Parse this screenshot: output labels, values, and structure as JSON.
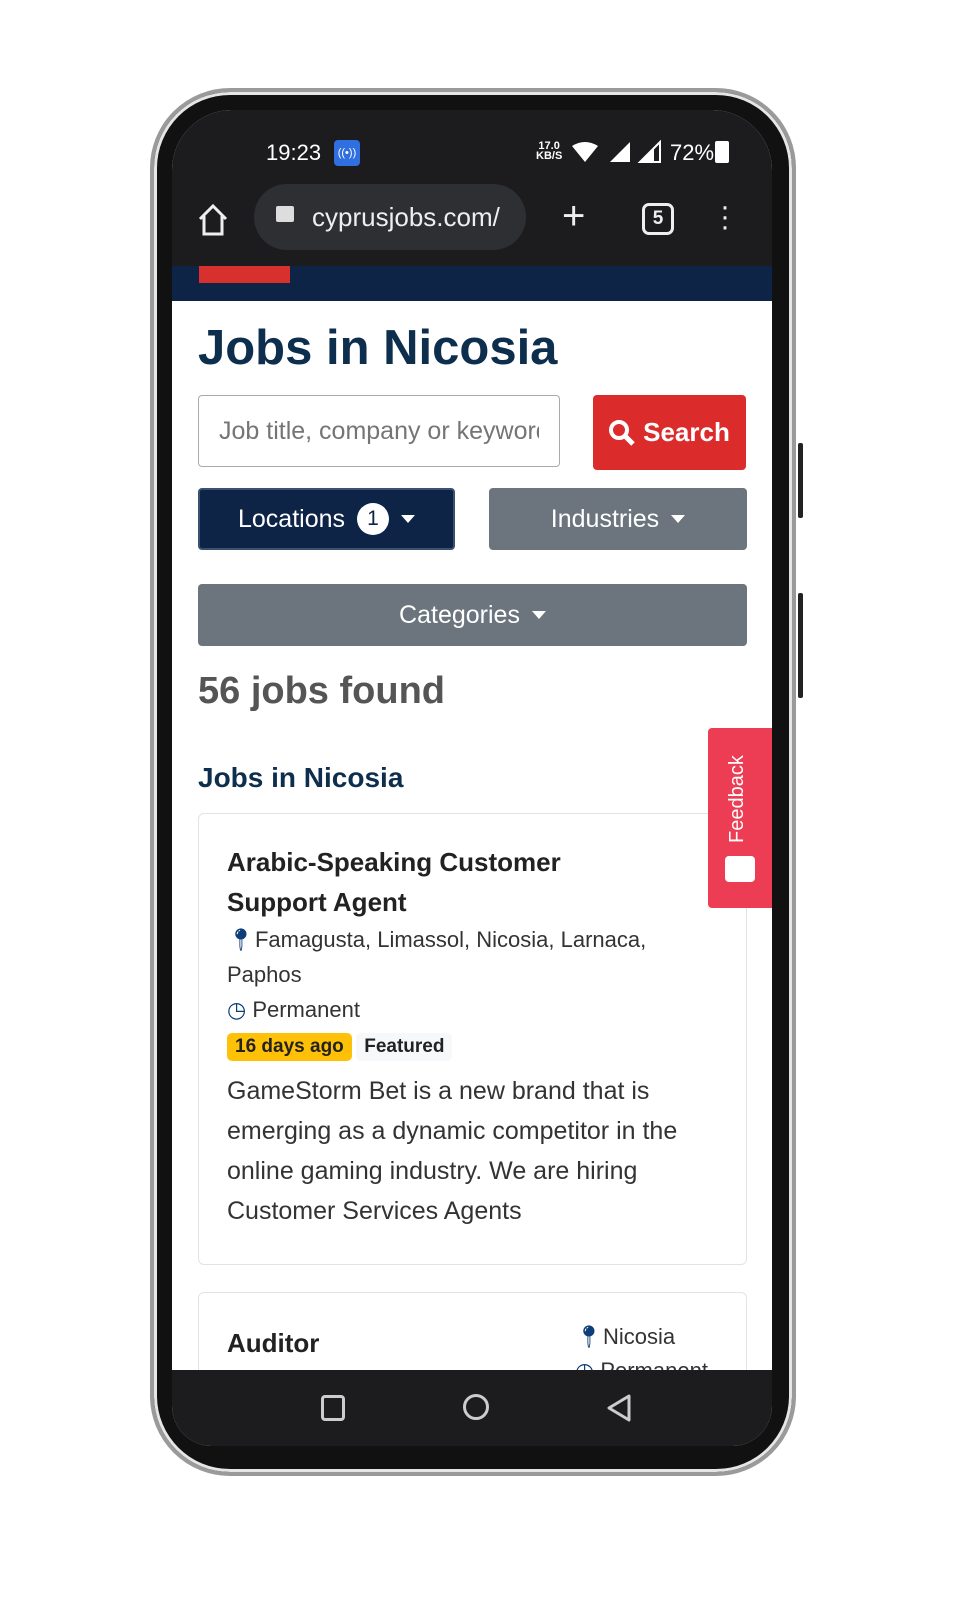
{
  "status_bar": {
    "time": "19:23",
    "net_speed_value": "17.0",
    "net_speed_unit": "KB/S",
    "battery": "72%"
  },
  "browser": {
    "url": "cyprusjobs.com/",
    "tab_count": "5"
  },
  "page": {
    "title": "Jobs in Nicosia",
    "search_placeholder": "Job title, company or keywords",
    "search_button": "Search",
    "filters": {
      "locations": "Locations",
      "locations_count": "1",
      "industries": "Industries",
      "categories": "Categories"
    },
    "results_count": "56 jobs found",
    "section_title": "Jobs in Nicosia"
  },
  "jobs": [
    {
      "title": "Arabic-Speaking Customer Support Agent",
      "locations": "Famagusta, Limassol, Nicosia, Larnaca, Paphos",
      "type": "Permanent",
      "posted": "16 days ago",
      "featured": "Featured",
      "description": "GameStorm Bet is a new brand that is emerging as a dynamic competitor in the online gaming industry. We are hiring Customer Services Agents"
    },
    {
      "title": "Auditor",
      "locations": "Nicosia",
      "type": "Permanent"
    }
  ],
  "feedback": {
    "label": "Feedback"
  },
  "colors": {
    "navy": "#0d2447",
    "red": "#dc2b2b",
    "gray_button": "#6c757d",
    "badge_yellow": "#ffc107",
    "feedback": "#ec3d54"
  }
}
